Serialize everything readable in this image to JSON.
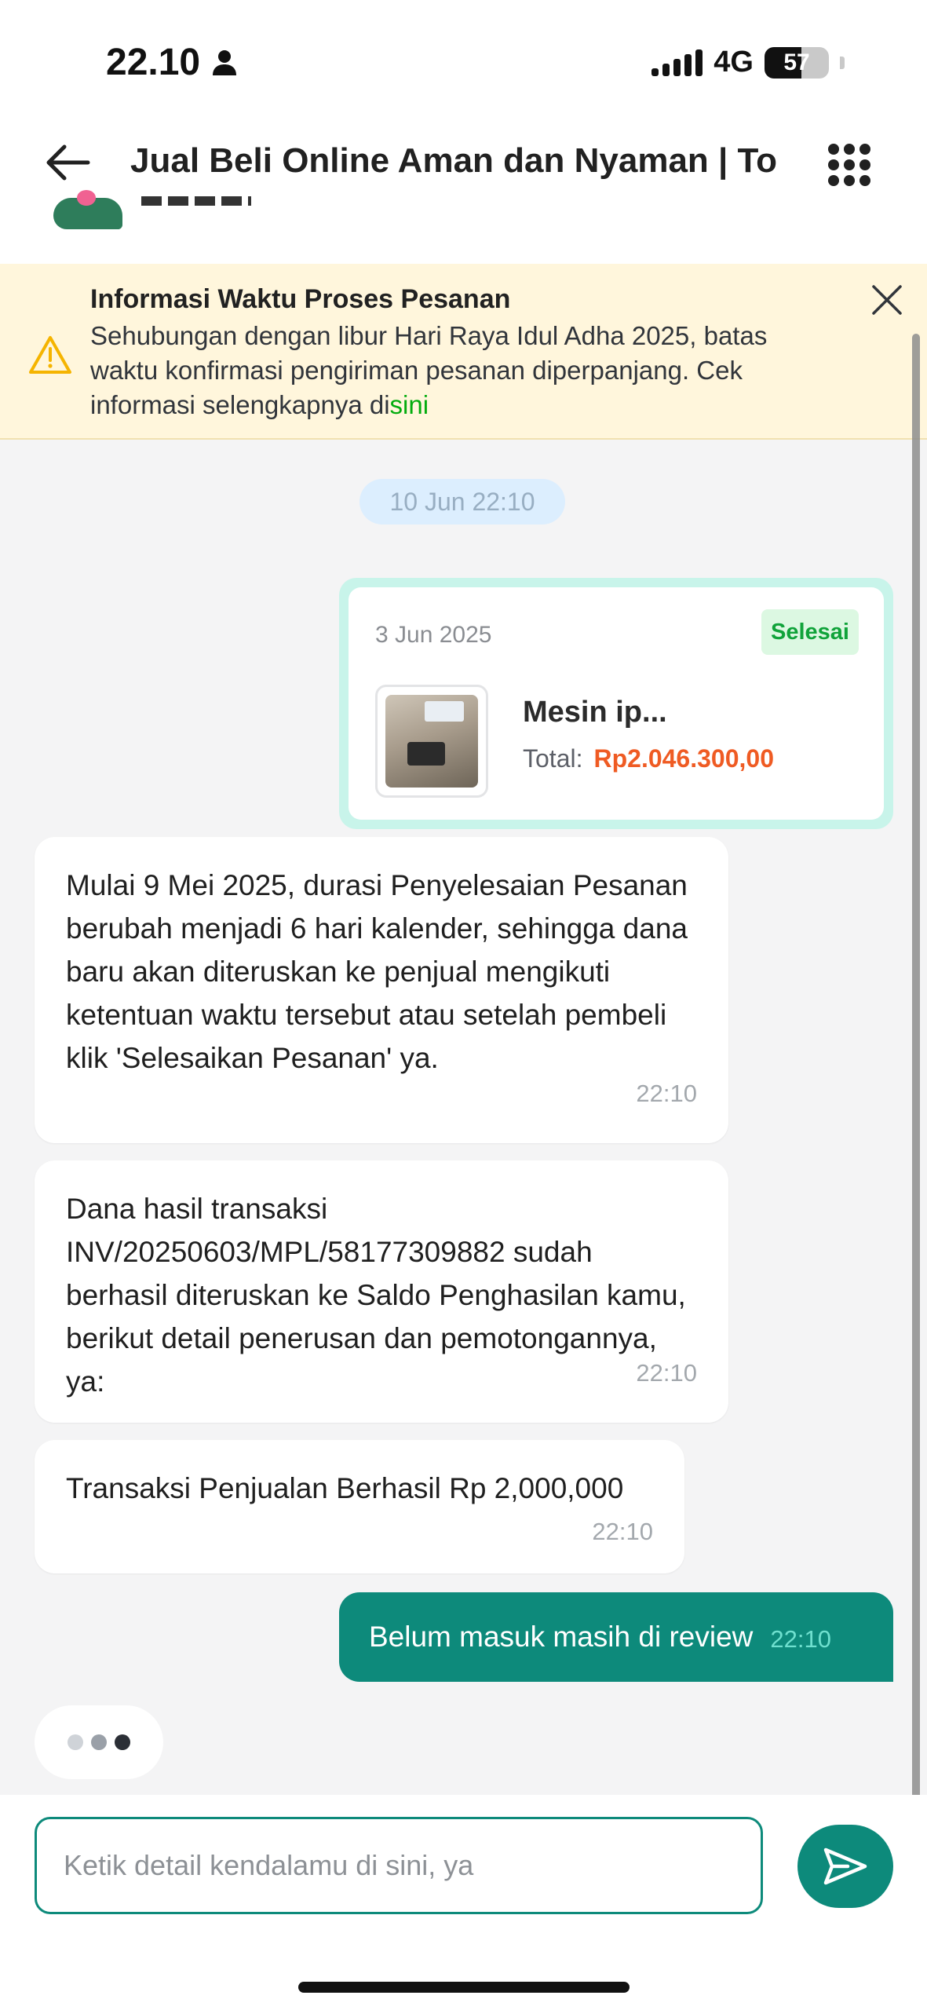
{
  "status_bar": {
    "time": "22.10",
    "network": "4G",
    "battery": "57",
    "battery_level": 0.57
  },
  "header": {
    "title": "Jual Beli Online Aman dan Nyaman | To"
  },
  "banner": {
    "title": "Informasi Waktu Proses Pesanan",
    "body": "Sehubungan dengan libur Hari Raya Idul Adha 2025, batas waktu konfirmasi pengiriman pesanan diperpanjang. Cek informasi selengkapnya di",
    "link": "sini"
  },
  "chat": {
    "date_chip": "10 Jun 22:10",
    "order_card": {
      "date": "3 Jun 2025",
      "status": "Selesai",
      "product_name": "Mesin ip...",
      "total_label": "Total:",
      "total_value": "Rp2.046.300,00"
    },
    "messages": [
      {
        "text": "Mulai 9 Mei 2025, durasi Penyelesaian Pesanan berubah menjadi 6 hari kalender, sehingga dana baru akan diteruskan ke penjual mengikuti ketentuan waktu tersebut atau setelah pembeli klik 'Selesaikan Pesanan' ya.",
        "time": "22:10"
      },
      {
        "text": "Dana hasil transaksi INV/20250603/MPL/58177309882 sudah berhasil diteruskan ke Saldo Penghasilan kamu, berikut detail penerusan dan pemotongannya, ya:",
        "time": "22:10"
      },
      {
        "text": "Transaksi Penjualan Berhasil Rp 2,000,000",
        "time": "22:10"
      }
    ],
    "outgoing": {
      "text": "Belum masuk masih di review",
      "time": "22:10"
    }
  },
  "composer": {
    "placeholder": "Ketik detail kendalamu di sini, ya"
  },
  "colors": {
    "primary": "#0d8a7b",
    "banner_bg": "#fff6dc",
    "status_green": "#10a33a",
    "price_orange": "#ef5b23",
    "link_green": "#03ac0e"
  }
}
